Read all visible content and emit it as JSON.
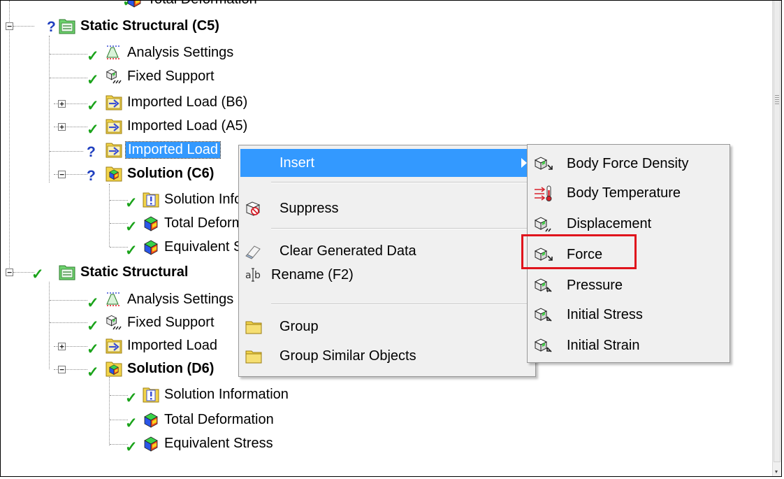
{
  "tree": {
    "items": [
      {
        "label": "Total Deformation",
        "status": "ok",
        "bold": false,
        "icon": "result-cube-icon",
        "partial": true
      },
      {
        "label": "Static Structural (C5)",
        "status": "question",
        "bold": true,
        "icon": "static-structural-folder-icon"
      },
      {
        "label": "Analysis Settings",
        "status": "ok",
        "bold": false,
        "icon": "analysis-settings-icon"
      },
      {
        "label": "Fixed Support",
        "status": "ok",
        "bold": false,
        "icon": "fixed-support-icon"
      },
      {
        "label": "Imported Load (B6)",
        "status": "ok",
        "bold": false,
        "icon": "imported-load-icon"
      },
      {
        "label": "Imported Load (A5)",
        "status": "ok",
        "bold": false,
        "icon": "imported-load-icon"
      },
      {
        "label": "Imported Load",
        "status": "question",
        "bold": false,
        "icon": "imported-load-icon",
        "selected": true
      },
      {
        "label": "Solution (C6)",
        "status": "question",
        "bold": true,
        "icon": "solution-icon"
      },
      {
        "label": "Solution Information",
        "status": "ok",
        "bold": false,
        "icon": "solution-information-icon"
      },
      {
        "label": "Total Deformation",
        "status": "ok",
        "bold": false,
        "icon": "result-cube-icon"
      },
      {
        "label": "Equivalent Stress",
        "status": "ok",
        "bold": false,
        "icon": "result-cube-icon"
      },
      {
        "label": "Static Structural",
        "status": "ok",
        "bold": true,
        "icon": "static-structural-folder-icon"
      },
      {
        "label": "Analysis Settings",
        "status": "ok",
        "bold": false,
        "icon": "analysis-settings-icon"
      },
      {
        "label": "Fixed Support",
        "status": "ok",
        "bold": false,
        "icon": "fixed-support-icon"
      },
      {
        "label": "Imported Load",
        "status": "ok",
        "bold": false,
        "icon": "imported-load-icon"
      },
      {
        "label": "Solution (D6)",
        "status": "ok",
        "bold": true,
        "icon": "solution-icon"
      },
      {
        "label": "Solution Information",
        "status": "ok",
        "bold": false,
        "icon": "solution-information-icon"
      },
      {
        "label": "Total Deformation",
        "status": "ok",
        "bold": false,
        "icon": "result-cube-icon"
      },
      {
        "label": "Equivalent Stress",
        "status": "ok",
        "bold": false,
        "icon": "result-cube-icon"
      }
    ],
    "status_glyphs": {
      "ok": "✓",
      "question": "?"
    },
    "expander_glyphs": {
      "collapse": "−",
      "expand": "+"
    }
  },
  "context_menu": {
    "items": [
      {
        "label": "Insert",
        "highlighted": true,
        "has_submenu": true
      },
      {
        "label": "Suppress",
        "icon": "suppress-icon"
      },
      {
        "label": "Clear Generated Data",
        "icon": "clear-data-icon"
      },
      {
        "label": "Rename (F2)",
        "icon": "rename-icon"
      },
      {
        "label": "Group",
        "icon": "group-folder-icon"
      },
      {
        "label": "Group Similar Objects",
        "icon": "group-folder-icon"
      }
    ]
  },
  "submenu": {
    "items": [
      {
        "label": "Body Force Density",
        "icon": "body-force-density-icon"
      },
      {
        "label": "Body Temperature",
        "icon": "body-temperature-icon"
      },
      {
        "label": "Displacement",
        "icon": "displacement-icon"
      },
      {
        "label": "Force",
        "icon": "force-icon",
        "annotated": true
      },
      {
        "label": "Pressure",
        "icon": "pressure-icon"
      },
      {
        "label": "Initial Stress",
        "icon": "initial-stress-icon"
      },
      {
        "label": "Initial Strain",
        "icon": "initial-strain-icon"
      }
    ]
  },
  "colors": {
    "selection": "#3399ff",
    "annotation_box": "#e0141c",
    "status_ok": "#1aa31a",
    "status_question": "#1f3fbf",
    "folder_green": "#6ed36e",
    "folder_yellow": "#f2d44a",
    "load_arrow": "#3a4fd6"
  }
}
